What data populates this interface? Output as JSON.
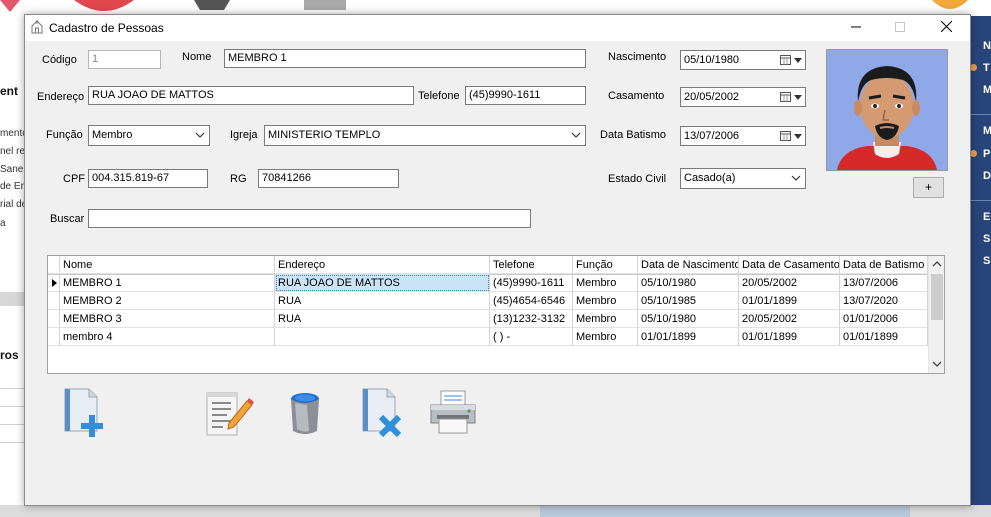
{
  "window": {
    "title": "Cadastro de Pessoas"
  },
  "form": {
    "codigo": {
      "label": "Código",
      "value": "1"
    },
    "nome": {
      "label": "Nome",
      "value": "MEMBRO 1"
    },
    "nascimento": {
      "label": "Nascimento",
      "value": "05/10/1980"
    },
    "endereco": {
      "label": "Endereço",
      "value": "RUA JOAO DE MATTOS"
    },
    "telefone": {
      "label": "Telefone",
      "value": "(45)9990-1611"
    },
    "casamento": {
      "label": "Casamento",
      "value": "20/05/2002"
    },
    "funcao": {
      "label": "Função",
      "value": "Membro"
    },
    "igreja": {
      "label": "Igreja",
      "value": "MINISTERIO TEMPLO"
    },
    "data_batismo": {
      "label": "Data Batismo",
      "value": "13/07/2006"
    },
    "cpf": {
      "label": "CPF",
      "value": "004.315.819-67"
    },
    "rg": {
      "label": "RG",
      "value": "70841266"
    },
    "estado_civil": {
      "label": "Estado Civil",
      "value": "Casado(a)"
    },
    "buscar": {
      "label": "Buscar",
      "value": ""
    },
    "add_photo_label": "+"
  },
  "grid": {
    "columns": [
      "Nome",
      "Endereço",
      "Telefone",
      "Função",
      "Data de Nascimento",
      "Data de Casamento",
      "Data de Batismo"
    ],
    "rows": [
      [
        "MEMBRO 1",
        "RUA JOAO DE MATTOS",
        "(45)9990-1611",
        "Membro",
        "05/10/1980",
        "20/05/2002",
        "13/07/2006"
      ],
      [
        "MEMBRO 2",
        "RUA",
        "(45)4654-6546",
        "Membro",
        "05/10/1985",
        "01/01/1899",
        "13/07/2020"
      ],
      [
        "MEMBRO 3",
        "RUA",
        "(13)1232-3132",
        "Membro",
        "05/10/1980",
        "20/05/2002",
        "01/01/2006"
      ],
      [
        "membro 4",
        "",
        "(  )    -",
        "Membro",
        "01/01/1899",
        "01/01/1899",
        "01/01/1899"
      ]
    ],
    "selected_row": 0,
    "selected_col": 1
  },
  "toolbar": {
    "icons": [
      "new-record-icon",
      "edit-icon",
      "trash-icon",
      "delete-record-icon",
      "printer-icon"
    ]
  },
  "background": {
    "left_texts": [
      "ent",
      "mento",
      "nel re",
      "Sane",
      "de Er",
      "rial de",
      "a",
      "ros"
    ],
    "right_letters": [
      "N",
      "T",
      "M",
      "M",
      "P",
      "D",
      "E",
      "S",
      "S"
    ]
  },
  "colors": {
    "accent": "#0078d7",
    "selection": "#cce4f7",
    "sidebar": "#27457a"
  }
}
